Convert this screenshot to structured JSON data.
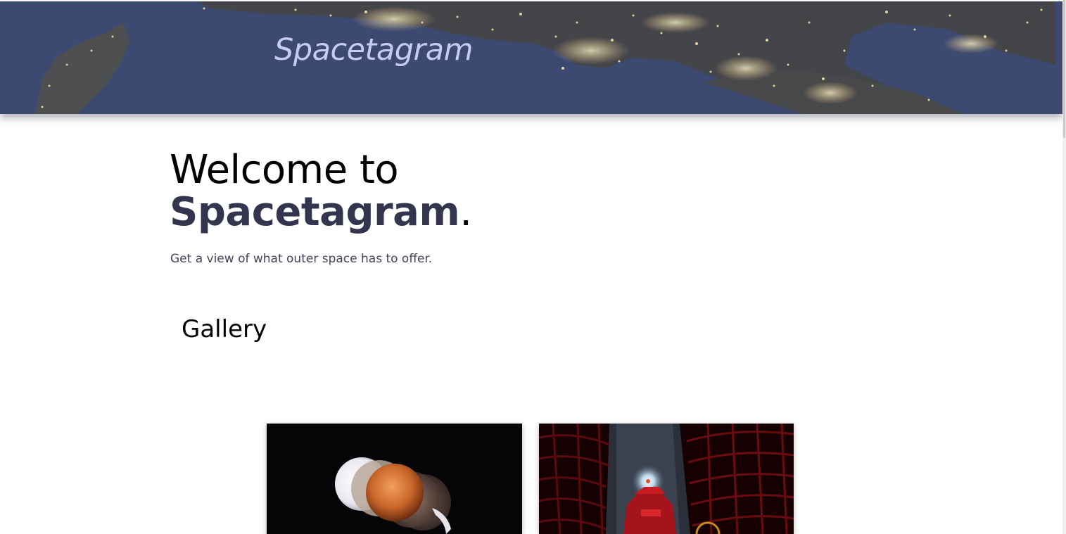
{
  "header": {
    "site_title": "Spacetagram"
  },
  "hero": {
    "heading_line1": "Welcome to",
    "heading_brand": "Spacetagram",
    "heading_punct": ".",
    "tagline": "Get a view of what outer space has to offer."
  },
  "gallery": {
    "title": "Gallery",
    "items": [
      {
        "image": "lunar-eclipse-sequence-photo"
      },
      {
        "image": "observatory-dome-red-light-photo"
      }
    ]
  },
  "colors": {
    "brand_accent": "#33354f",
    "banner_title": "#c7cdef",
    "banner_base": "#3a4868"
  }
}
